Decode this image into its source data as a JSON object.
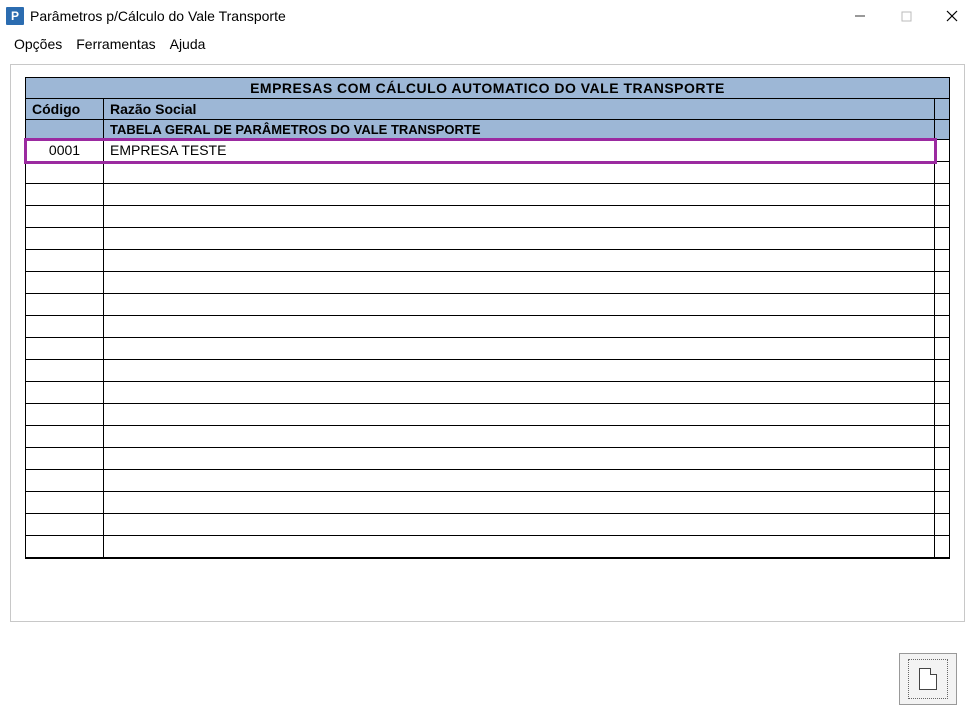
{
  "window": {
    "title": "Parâmetros p/Cálculo do Vale Transporte",
    "app_icon_letter": "P"
  },
  "menu": {
    "opcoes": "Opções",
    "ferramentas": "Ferramentas",
    "ajuda": "Ajuda"
  },
  "table": {
    "title": "EMPRESAS COM CÁLCULO AUTOMATICO DO VALE TRANSPORTE",
    "columns": {
      "codigo": "Código",
      "razao": "Razão Social"
    },
    "subheader": "TABELA GERAL DE PARÂMETROS DO VALE TRANSPORTE",
    "rows": [
      {
        "codigo": "0001",
        "razao": "EMPRESA TESTE"
      }
    ],
    "empty_rows": 18
  },
  "buttons": {
    "new_doc": "Novo"
  }
}
